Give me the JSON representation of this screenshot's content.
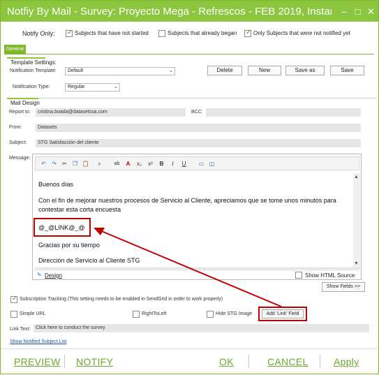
{
  "window": {
    "title": "Notfiy By Mail - Survey: Proyecto Mega - Refrescos - FEB 2019, Instance: Ins...",
    "controls": {
      "minimize": "–",
      "maximize": "□",
      "close": "✕"
    }
  },
  "notify_only": {
    "label": "Notify Only:",
    "options": [
      {
        "label": "Subjects that have not started",
        "checked": true
      },
      {
        "label": "Subjects that already began",
        "checked": false
      },
      {
        "label": "Only Subjects that were not notified yet",
        "checked": true
      }
    ]
  },
  "tabs": {
    "general": "General"
  },
  "template_settings": {
    "title": "Template Settings:",
    "notification_template_label": "Notification Template:",
    "notification_template_value": "Default",
    "notification_type_label": "Notification Type:",
    "notification_type_value": "Regular",
    "buttons": {
      "delete": "Delete",
      "new": "New",
      "save_as": "Save as",
      "save": "Save"
    }
  },
  "mail_design": {
    "title": "Mail Design",
    "report_to_label": "Report to:",
    "report_to_value": "cristina.boada@datasetssa.com",
    "bcc_label": "BCC:",
    "bcc_value": "",
    "from_label": "From:",
    "from_value": "Datasets",
    "subject_label": "Subject:",
    "subject_value": "STG Satisfacción del cliente",
    "message_label": "Message:"
  },
  "editor": {
    "toolbar_icons": [
      "undo-icon",
      "redo-icon",
      "cut-icon",
      "copy-icon",
      "paste-icon",
      "find-icon",
      "spellcheck-icon",
      "font-color-icon",
      "subscript-icon",
      "superscript-icon",
      "bold-icon",
      "italic-icon",
      "underline-icon",
      "insert-image-icon",
      "insert-link-icon"
    ],
    "lines": {
      "greeting": "Buenos días",
      "body": "Con el fin de mejorar nuestros procesos de Servicio al Cliente, apreciamos que se tome unos minutos para contestar esta corta encuesta",
      "link_token": "@_@LINK@_@",
      "thanks": "Gracias por su tiempo",
      "signature": "Dirección de Servicio al Cliente STG"
    },
    "design_tab": "Design",
    "show_html_source": "Show HTML Source"
  },
  "options": {
    "show_fields": "Show Fields >>",
    "subscription_tracking": "Subscription Tracking (This setting needs to be enabled in SendGrid in order to work properly)",
    "subscription_tracking_checked": true,
    "simple_url": "Simple URL",
    "right_to_left": "RightToLeft",
    "hide_stg_image": "Hide STG Image",
    "add_link_field": "Add 'Link' Field",
    "link_text_label": "Link Text:",
    "link_text_value": "Click here to conduct the survey",
    "show_notified": "Show Notified Subject List"
  },
  "footer": {
    "preview": "PREVIEW",
    "notify": "NOTIFY",
    "ok": "OK",
    "cancel": "CANCEL",
    "apply": "Apply"
  },
  "colors": {
    "accent": "#8cc63f",
    "annotation": "#c00000",
    "link": "#6aa82a"
  }
}
